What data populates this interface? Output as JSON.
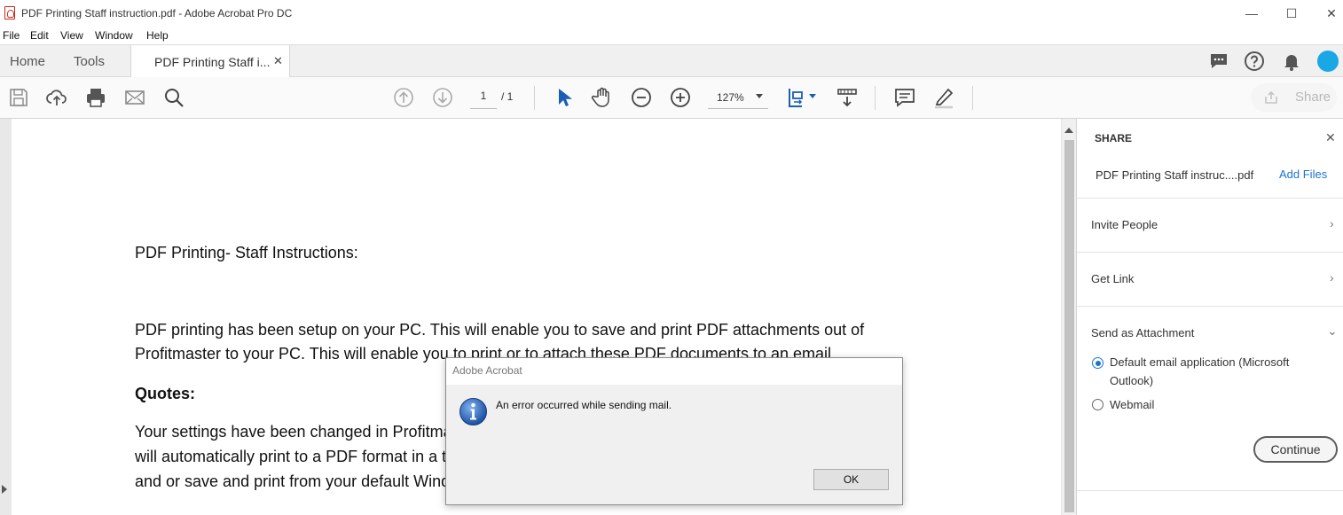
{
  "window": {
    "title": "PDF Printing Staff instruction.pdf - Adobe Acrobat Pro DC",
    "controls": {
      "minimize": "—",
      "maximize": "☐",
      "close": "✕"
    }
  },
  "menu": [
    "File",
    "Edit",
    "View",
    "Window",
    "Help"
  ],
  "tabs": {
    "home": "Home",
    "tools": "Tools",
    "document": "PDF Printing Staff i...",
    "close": "✕"
  },
  "toolbar": {
    "page_current": "1",
    "page_total": "/ 1",
    "zoom": "127%",
    "share_label": "Share"
  },
  "document": {
    "heading": "PDF Printing- Staff Instructions:",
    "para1_line1": "PDF printing has been setup on your PC.  This will enable you to save and print PDF attachments out of",
    "para1_line2": "Profitmaster to your PC.  This will enable you to print or to attach these PDF documents to an email.",
    "quotes_heading": "Quotes:",
    "para2_line1": "Your settings have been changed in Profitmaster so that when you print a Quote or Invoice, the document es",
    "para2_line2": "will automatically print to a PDF format in a temporary location from where you can then attach to an email e",
    "para2_line3": "and or save and print from your default Windows PDF viewer."
  },
  "share_panel": {
    "title": "SHARE",
    "close": "✕",
    "file_name": "PDF Printing Staff instruc....pdf",
    "add_files": "Add Files",
    "invite_people": "Invite People",
    "get_link": "Get Link",
    "send_as_attachment": "Send as Attachment",
    "option_default_line1": "Default email application (Microsoft",
    "option_default_line2": "Outlook)",
    "option_webmail": "Webmail",
    "continue": "Continue"
  },
  "dialog": {
    "title": "Adobe Acrobat",
    "message": "An error occurred while sending mail.",
    "ok": "OK"
  },
  "colors": {
    "accent_blue": "#1a73d1",
    "icon_grey": "#555555"
  }
}
